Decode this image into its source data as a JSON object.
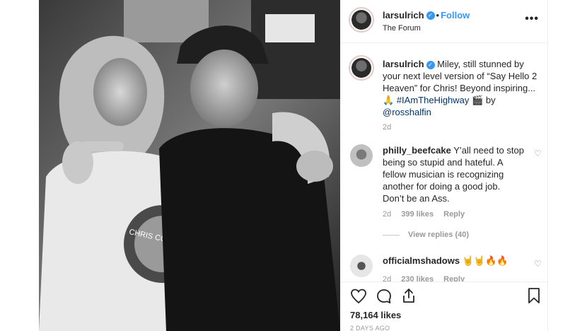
{
  "post": {
    "username": "larsulrich",
    "follow_label": "Follow",
    "separator": "•",
    "location": "The Forum",
    "more_label": "•••",
    "photo_caption_text": "CHRIS CORNELL"
  },
  "caption": {
    "username": "larsulrich",
    "text_1": "Miley, still stunned by your next level version of “Say Hello 2 Heaven” for Chris! Beyond inspiring...",
    "emoji_pray": "🙏",
    "hashtag": "#IAmTheHighway",
    "emoji_film": "🎬",
    "text_by": "by",
    "mention": "@rosshalfin",
    "age": "2d"
  },
  "comments": [
    {
      "username": "philly_beefcake",
      "text": "Y’all need to stop being so stupid and hateful. A fellow musician is recognizing another for doing a good job. Don’t be an Ass.",
      "age": "2d",
      "likes": "399 likes",
      "reply": "Reply",
      "view_replies": "View replies (40)"
    },
    {
      "username": "officialmshadows",
      "text": "🤘🤘🔥🔥",
      "age": "2d",
      "likes": "230 likes",
      "reply": "Reply"
    }
  ],
  "actions": {
    "likes_count": "78,164 likes",
    "date": "2 DAYS AGO"
  },
  "colors": {
    "accent": "#3897f0",
    "hashtag": "#003569",
    "muted": "#999999"
  }
}
